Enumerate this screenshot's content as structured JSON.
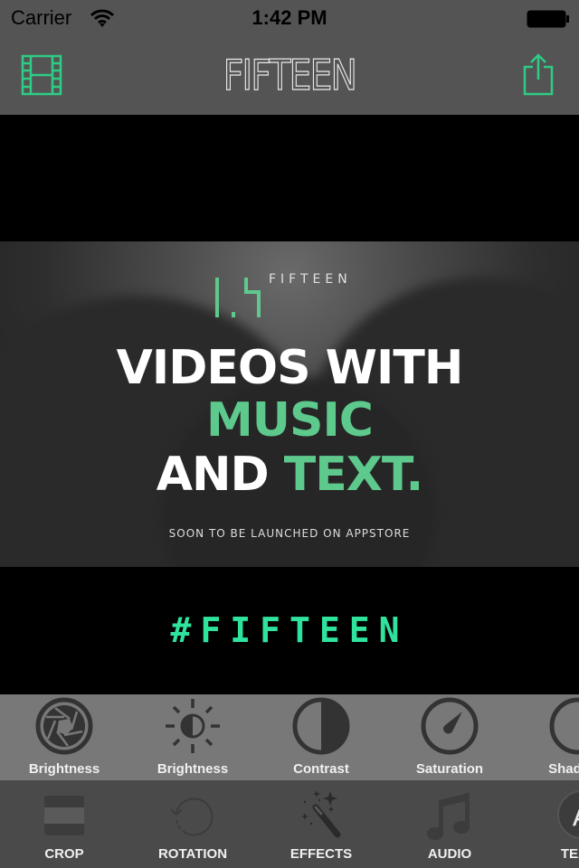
{
  "status_bar": {
    "carrier": "Carrier",
    "time": "1:42 PM",
    "wifi_icon": "wifi-icon",
    "battery_icon": "battery-full-icon"
  },
  "nav": {
    "title": "FIFTEEN",
    "left_icon": "film-strip-icon",
    "right_icon": "share-icon",
    "accent_color": "#2ecc85"
  },
  "video": {
    "logo_word": "FIFTEEN",
    "headline_line1": "VIDEOS WITH",
    "headline_line2": "MUSIC",
    "headline_line3_white": "AND ",
    "headline_line3_green": "TEXT.",
    "subline": "SOON TO BE LAUNCHED ON APPSTORE",
    "hashtag": "#FIFTEEN",
    "hashtag_color": "#2fe39d",
    "highlight_color": "#5ec98d"
  },
  "adjustments": [
    {
      "label": "Brightness",
      "icon": "aperture-icon"
    },
    {
      "label": "Brightness",
      "icon": "brightness-icon"
    },
    {
      "label": "Contrast",
      "icon": "contrast-icon"
    },
    {
      "label": "Saturation",
      "icon": "gauge-icon"
    },
    {
      "label": "Shadows",
      "icon": "shadows-icon"
    }
  ],
  "tools": [
    {
      "label": "CROP",
      "icon": "crop-icon"
    },
    {
      "label": "ROTATION",
      "icon": "rotation-icon"
    },
    {
      "label": "EFFECTS",
      "icon": "magic-wand-icon"
    },
    {
      "label": "AUDIO",
      "icon": "music-note-icon"
    },
    {
      "label": "TEXT",
      "icon": "text-icon"
    }
  ]
}
